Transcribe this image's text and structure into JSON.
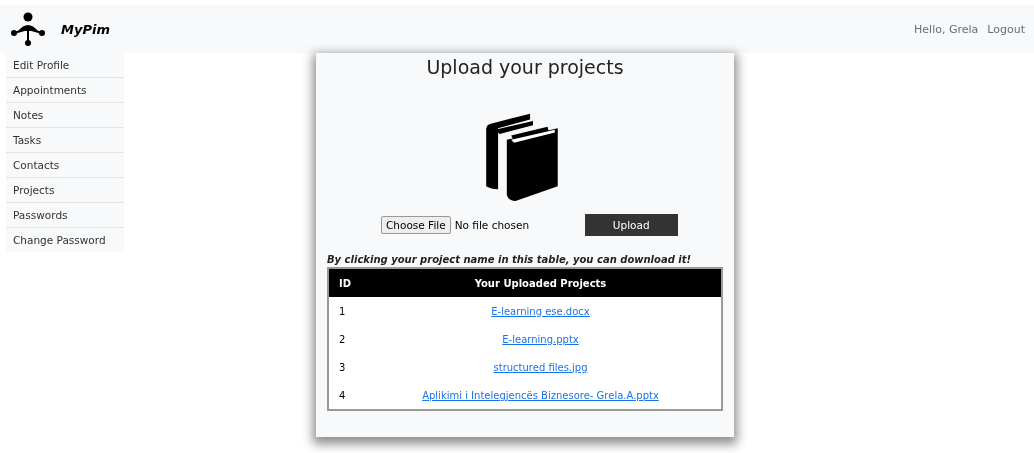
{
  "brand": "MyPim",
  "user": {
    "greeting": "Hello, Grela",
    "logout": "Logout"
  },
  "sidebar": {
    "items": [
      "Edit Profile",
      "Appointments",
      "Notes",
      "Tasks",
      "Contacts",
      "Projects",
      "Passwords",
      "Change Password"
    ]
  },
  "upload": {
    "title": "Upload your projects",
    "choose_button": "Choose File",
    "file_status": "No file chosen",
    "upload_button": "Upload"
  },
  "hint": "By clicking your project name in this table, you can download it!",
  "table": {
    "columns": [
      "ID",
      "Your Uploaded Projects"
    ],
    "rows": [
      {
        "id": "1",
        "name": "E-learning ese.docx"
      },
      {
        "id": "2",
        "name": "E-learning.pptx"
      },
      {
        "id": "3",
        "name": "structured files.jpg"
      },
      {
        "id": "4",
        "name": "Aplikimi i Intelegjencës Biznesore- Grela.A.pptx"
      }
    ]
  }
}
